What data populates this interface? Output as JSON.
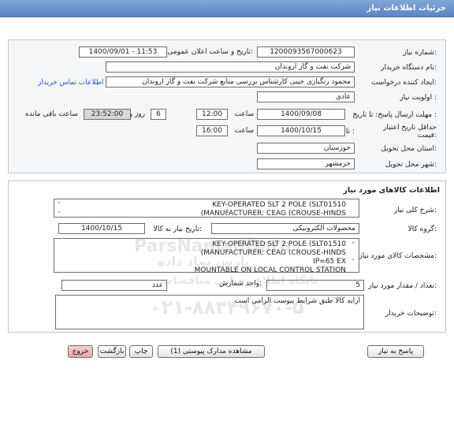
{
  "header": {
    "title": "جزئیات اطلاعات نیاز"
  },
  "need": {
    "number_label": "شماره نیاز:",
    "number_value": "1200093567000623",
    "announce_label": "تاریخ و ساعت اعلان عمومی:",
    "announce_value": "1400/09/01 - 11:53",
    "buyer_org_label": "نام دستگاه خریدار:",
    "buyer_org_value": "شرکت نفت و گاز اروندان",
    "creator_label": "ایجاد کننده درخواست:",
    "creator_value": "محمود رنگباری خیبی کارشناس بررسی منابع شرکت نفت و گاز اروندان",
    "contact_link": "اطلاعات تماس خریدار",
    "priority_label": "اولویت نیاز :",
    "priority_value": "عادی",
    "deadline_label": "مهلت ارسال پاسخ: تا تاریخ :",
    "deadline_date": "1400/09/08",
    "time_label": "ساعت",
    "deadline_time": "12:00",
    "days_value": "6",
    "days_label": "روز و",
    "remaining_time": "23:52:00",
    "remaining_label": "ساعت باقی مانده",
    "validity_label_1": "حداقل تاریخ اعتبار",
    "validity_label_2": "قیمت:",
    "validity_to_label": "تا تاریخ :",
    "validity_date": "1400/10/15",
    "validity_time_label": "ساعت",
    "validity_time": "16:00",
    "province_label": "استان محل تحویل:",
    "province_value": "خوزستان",
    "city_label": "شهر محل تحویل:",
    "city_value": "خرمشهر"
  },
  "goods": {
    "section_title": "اطلاعات کالاهای مورد نیاز",
    "summary_label": "شرح کلی نیاز:",
    "summary_line1": "KEY-OPERATED SLT 2 POLE (SLT01510",
    "summary_line2": "(MANUFACTURER: CEAG (CROUSE-HINDS",
    "group_label": "گروه کالا:",
    "group_value": "محصولات الکترونیکی",
    "need_date_label": "تاریخ نیاز به کالا:",
    "need_date_value": "1400/10/15",
    "spec_label": "مشخصات کالای مورد نیاز:",
    "spec_line1": "KEY-OPERATED SLT 2 POLE (SLT01510",
    "spec_line2": "(MANUFACTURER: CEAG (CROUSE-HINDS",
    "spec_line3": "IP=65 EX",
    "spec_line4": "MOUNTABLE ON LOCAL CONTROL STATION",
    "qty_label": "تعداد / مقدار مورد نیاز:",
    "qty_value": "5",
    "unit_label": "واحد شمارش:",
    "unit_value": "عدد",
    "desc_label": "توضیحات خریدار:",
    "desc_value": "ارایه کالا طبق شرایط پیوست الزامی است"
  },
  "watermark": {
    "line1": "ParsNamadData",
    "line2": "پارس نماد داده",
    "line3": "پایگاه اطلاع رسانی مناقصات",
    "line4": "۰۲۱-۸۸۳۴۹۶۷۰-۵"
  },
  "buttons": {
    "reply": "پاسخ به نیاز",
    "attachments": "مشاهده مدارک پیوستی (1)",
    "print": "چاپ",
    "back": "بازگشت",
    "exit": "خروج"
  }
}
